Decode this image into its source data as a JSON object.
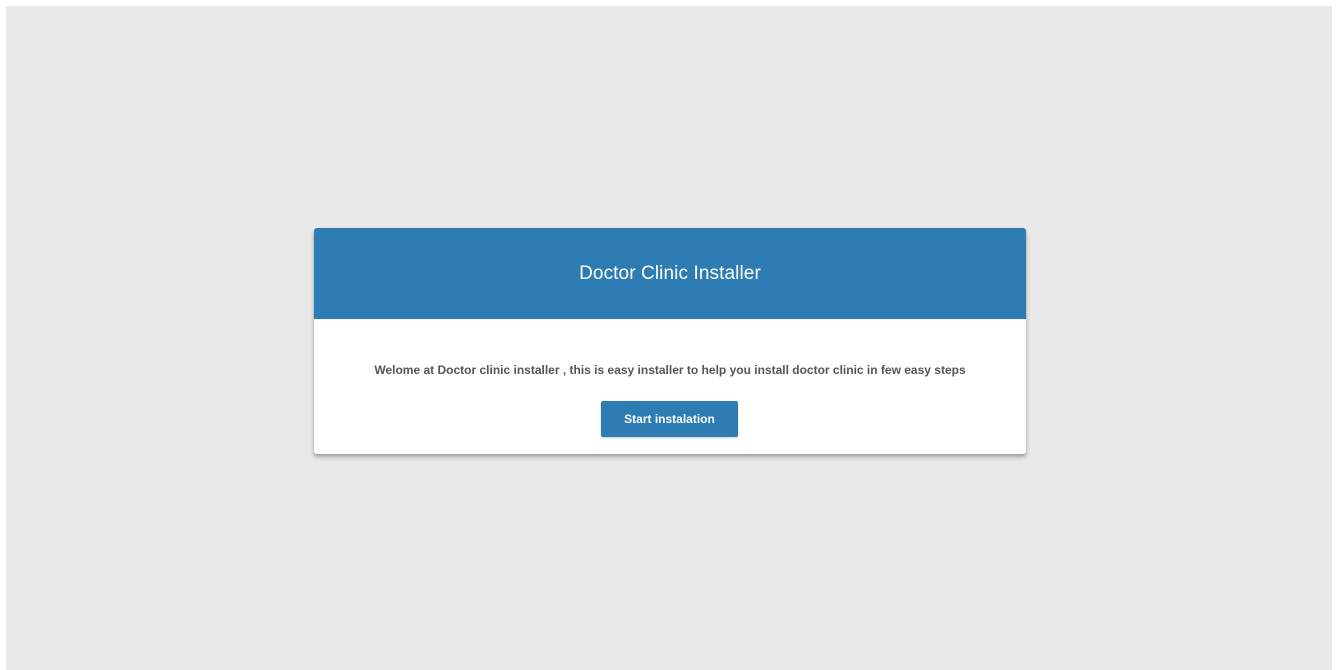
{
  "installer": {
    "title": "Doctor Clinic Installer",
    "welcome_text": "Welome at Doctor clinic installer , this is easy installer to help you install doctor clinic in few easy steps",
    "start_button_label": "Start instalation"
  },
  "colors": {
    "page_background": "#e9e9e9",
    "header_background": "#2d7db4",
    "button_background": "#2d7db4",
    "card_background": "#ffffff",
    "body_text": "#555555"
  }
}
